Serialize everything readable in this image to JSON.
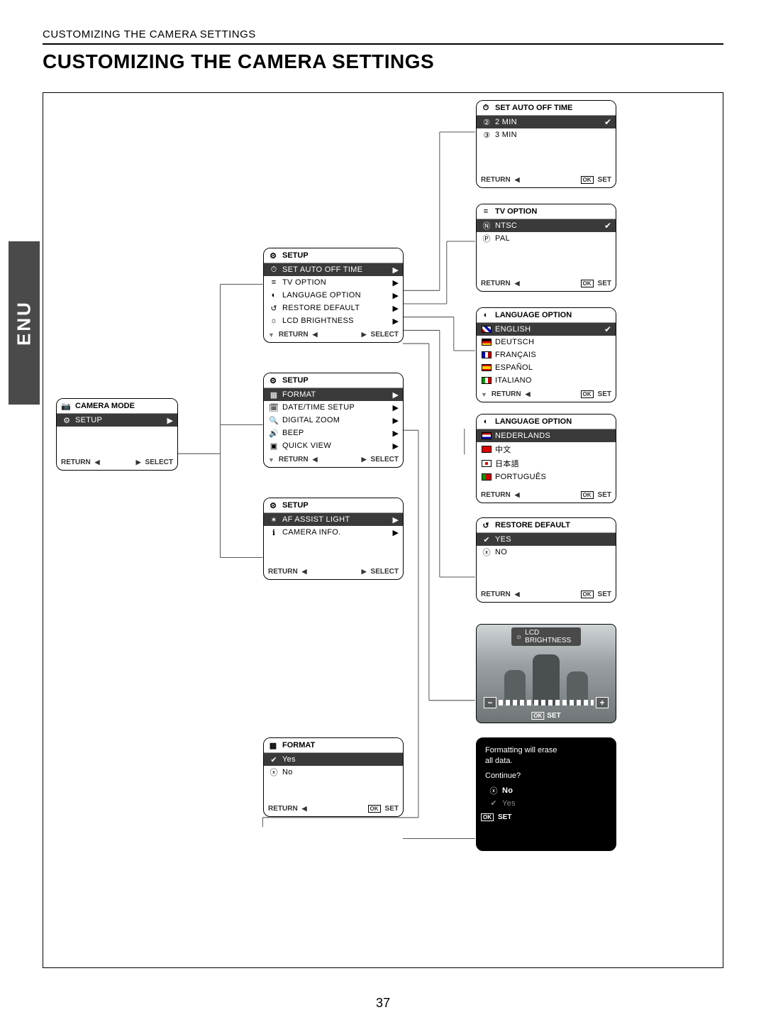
{
  "running_head": "CUSTOMIZING THE CAMERA SETTINGS",
  "title": "CUSTOMIZING THE CAMERA SETTINGS",
  "side_tab": "ENU",
  "page_number": "37",
  "camera_mode": {
    "title": "CAMERA MODE",
    "items": [
      {
        "label": "SETUP",
        "selected": true
      }
    ],
    "footer_return": "RETURN",
    "footer_select": "SELECT"
  },
  "setup1": {
    "title": "SETUP",
    "items": [
      {
        "label": "SET AUTO OFF TIME",
        "selected": true
      },
      {
        "label": "TV OPTION"
      },
      {
        "label": "LANGUAGE OPTION"
      },
      {
        "label": "RESTORE DEFAULT"
      },
      {
        "label": "LCD BRIGHTNESS"
      }
    ],
    "footer_return": "RETURN",
    "footer_select": "SELECT"
  },
  "setup2": {
    "title": "SETUP",
    "items": [
      {
        "label": "FORMAT",
        "selected": true
      },
      {
        "label": "DATE/TIME SETUP"
      },
      {
        "label": "DIGITAL ZOOM"
      },
      {
        "label": "BEEP"
      },
      {
        "label": "QUICK VIEW"
      }
    ],
    "footer_return": "RETURN",
    "footer_select": "SELECT"
  },
  "setup3": {
    "title": "SETUP",
    "items": [
      {
        "label": "AF ASSIST LIGHT",
        "selected": true
      },
      {
        "label": "CAMERA INFO."
      }
    ],
    "footer_return": "RETURN",
    "footer_select": "SELECT"
  },
  "auto_off": {
    "title": "SET AUTO OFF TIME",
    "items": [
      {
        "label": "2 MIN",
        "selected": true,
        "check": true
      },
      {
        "label": "3 MIN"
      }
    ],
    "footer_return": "RETURN",
    "footer_set": "SET"
  },
  "tv_option": {
    "title": "TV  OPTION",
    "items": [
      {
        "label": "NTSC",
        "selected": true,
        "check": true
      },
      {
        "label": "PAL"
      }
    ],
    "footer_return": "RETURN",
    "footer_set": "SET"
  },
  "language1": {
    "title": "LANGUAGE  OPTION",
    "items": [
      {
        "label": "ENGLISH",
        "selected": true,
        "check": true
      },
      {
        "label": "DEUTSCH"
      },
      {
        "label": "FRANÇAIS"
      },
      {
        "label": "ESPAÑOL"
      },
      {
        "label": "ITALIANO"
      }
    ],
    "footer_return": "RETURN",
    "footer_set": "SET"
  },
  "language2": {
    "title": "LANGUAGE  OPTION",
    "items": [
      {
        "label": "NEDERLANDS",
        "selected": true
      },
      {
        "label": "中文"
      },
      {
        "label": "日本語"
      },
      {
        "label": "PORTUGUÊS"
      }
    ],
    "footer_return": "RETURN",
    "footer_set": "SET"
  },
  "restore": {
    "title": "RESTORE DEFAULT",
    "items": [
      {
        "label": "YES",
        "selected": true
      },
      {
        "label": "NO"
      }
    ],
    "footer_return": "RETURN",
    "footer_set": "SET"
  },
  "lcd": {
    "title": "LCD BRIGHTNESS",
    "footer_set": "SET"
  },
  "format_panel": {
    "title": "FORMAT",
    "items": [
      {
        "label": "Yes",
        "selected": true
      },
      {
        "label": "No"
      }
    ],
    "footer_return": "RETURN",
    "footer_set": "SET"
  },
  "format_warn": {
    "line1": "Formatting will erase",
    "line2": "all data.",
    "line3": "Continue?",
    "no": "No",
    "yes": "Yes",
    "footer_set": "SET"
  }
}
